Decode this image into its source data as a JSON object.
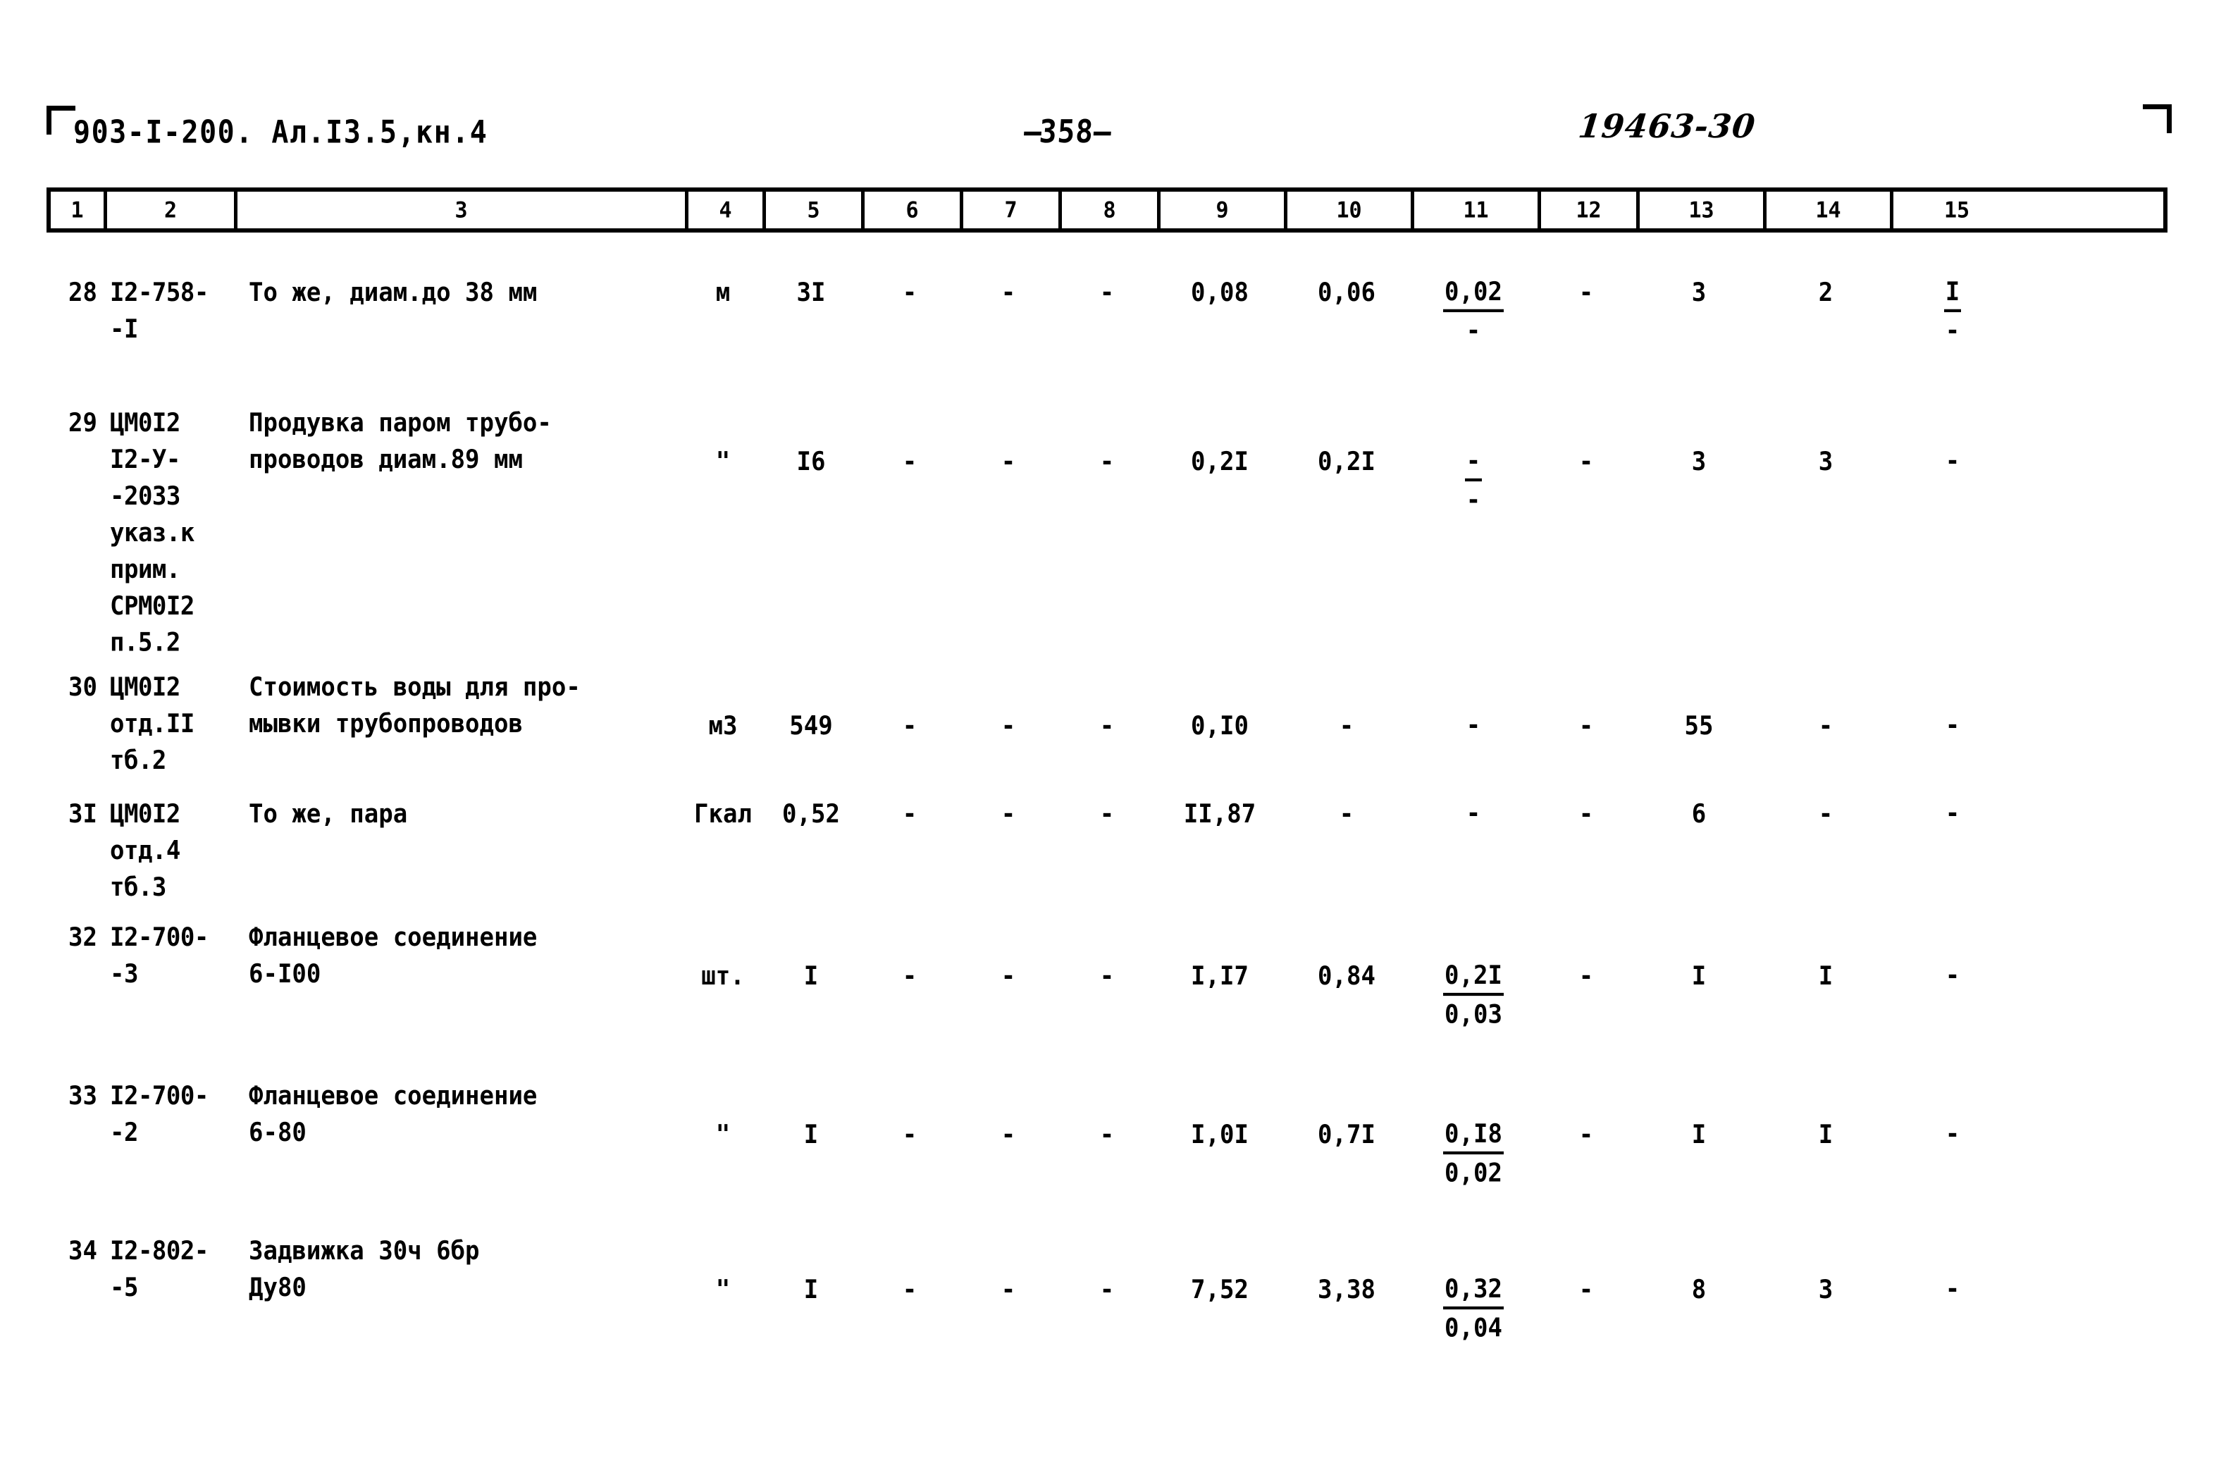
{
  "header": {
    "doc_code": "903-I-200. Ал.I3.5,кн.4",
    "page_number": "358",
    "page_number_prefix": "—",
    "page_number_suffix": "—",
    "stamp": "19463-30"
  },
  "table": {
    "column_headers": [
      "1",
      "2",
      "3",
      "4",
      "5",
      "6",
      "7",
      "8",
      "9",
      "10",
      "11",
      "12",
      "13",
      "14",
      "15"
    ],
    "rows": [
      {
        "num": "28",
        "code": "I2-758-\n-I",
        "desc": "То же, диам.до 38 мм",
        "unit": "м",
        "c5": "3I",
        "c6": "-",
        "c7": "-",
        "c8": "-",
        "c9": "0,08",
        "c10": "0,06",
        "c11_top": "0,02",
        "c11_bot": "-",
        "c12": "-",
        "c13": "3",
        "c14": "2",
        "c15_top": "I",
        "c15_bot": "-"
      },
      {
        "num": "29",
        "code": "ЦМ0I2\nI2-У-\n-2033\nуказ.к\nприм.\nСРМ0I2\nп.5.2",
        "desc": "Продувка паром трубо-\nпроводов диам.89 мм",
        "unit": "\"",
        "c5": "I6",
        "c6": "-",
        "c7": "-",
        "c8": "-",
        "c9": "0,2I",
        "c10": "0,2I",
        "c11_top": "-",
        "c11_bot": "-",
        "c12": "-",
        "c13": "3",
        "c14": "3",
        "c15_top": "-",
        "c15_bot": ""
      },
      {
        "num": "30",
        "code": "ЦМ0I2\nотд.II\nтб.2",
        "desc": "Стоимость воды для про-\nмывки трубопроводов",
        "unit": "м3",
        "c5": "549",
        "c6": "-",
        "c7": "-",
        "c8": "-",
        "c9": "0,I0",
        "c10": "-",
        "c11_top": "-",
        "c11_bot": "",
        "c12": "-",
        "c13": "55",
        "c14": "-",
        "c15_top": "-",
        "c15_bot": ""
      },
      {
        "num": "3I",
        "code": "ЦМ0I2\nотд.4\nтб.3",
        "desc": "То же, пара",
        "unit": "Гкал",
        "c5": "0,52",
        "c6": "-",
        "c7": "-",
        "c8": "-",
        "c9": "II,87",
        "c10": "-",
        "c11_top": "-",
        "c11_bot": "",
        "c12": "-",
        "c13": "6",
        "c14": "-",
        "c15_top": "-",
        "c15_bot": ""
      },
      {
        "num": "32",
        "code": "I2-700-\n-3",
        "desc": "Фланцевое соединение\n6-I00",
        "unit": "шт.",
        "c5": "I",
        "c6": "-",
        "c7": "-",
        "c8": "-",
        "c9": "I,I7",
        "c10": "0,84",
        "c11_top": "0,2I",
        "c11_bot": "0,03",
        "c12": "-",
        "c13": "I",
        "c14": "I",
        "c15_top": "-",
        "c15_bot": ""
      },
      {
        "num": "33",
        "code": "I2-700-\n-2",
        "desc": "Фланцевое соединение\n6-80",
        "unit": "\"",
        "c5": "I",
        "c6": "-",
        "c7": "-",
        "c8": "-",
        "c9": "I,0I",
        "c10": "0,7I",
        "c11_top": "0,I8",
        "c11_bot": "0,02",
        "c12": "-",
        "c13": "I",
        "c14": "I",
        "c15_top": "-",
        "c15_bot": ""
      },
      {
        "num": "34",
        "code": "I2-802-\n-5",
        "desc": "Задвижка 30ч 6бр\nДу80",
        "unit": "\"",
        "c5": "I",
        "c6": "-",
        "c7": "-",
        "c8": "-",
        "c9": "7,52",
        "c10": "3,38",
        "c11_top": "0,32",
        "c11_bot": "0,04",
        "c12": "-",
        "c13": "8",
        "c14": "3",
        "c15_top": "-",
        "c15_bot": ""
      }
    ]
  }
}
